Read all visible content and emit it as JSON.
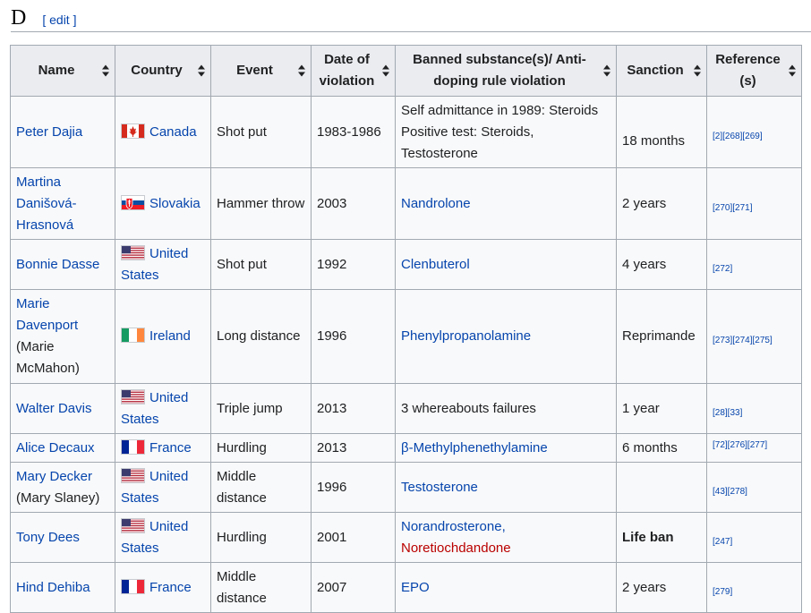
{
  "heading": {
    "title": "D",
    "edit_label": "[ edit ]"
  },
  "columns": [
    "Name",
    "Country",
    "Event",
    "Date of violation",
    "Banned substance(s)/ Anti-doping rule violation",
    "Sanction",
    "Reference (s)"
  ],
  "rows": [
    {
      "name": "Peter Dajia",
      "country": "Canada",
      "flag": "canada-flag-icon",
      "event": "Shot put",
      "date": "1983-1986",
      "substance_lines": [
        "Self admittance in 1989: Steroids",
        "Positive test: Steroids, Testosterone"
      ],
      "sanction": "18 months",
      "refs": "[2][268][269]"
    },
    {
      "name": "Martina Danišová-Hrasnová",
      "country": "Slovakia",
      "flag": "slovakia-flag-icon",
      "event": "Hammer throw",
      "date": "2003",
      "substance": "Nandrolone",
      "sanction": "2 years",
      "refs": "[270][271]"
    },
    {
      "name": "Bonnie Dasse",
      "country": "United States",
      "flag": "united-states-flag-icon",
      "event": "Shot put",
      "date": "1992",
      "substance": "Clenbuterol",
      "sanction": "4 years",
      "refs": "[272]"
    },
    {
      "name": "Marie Davenport",
      "name_note": "(Marie McMahon)",
      "country": "Ireland",
      "flag": "ireland-flag-icon",
      "event": "Long distance",
      "date": "1996",
      "substance": "Phenylpropanolamine",
      "sanction": "Reprimande",
      "refs": "[273][274][275]"
    },
    {
      "name": "Walter Davis",
      "country": "United States",
      "flag": "united-states-flag-icon",
      "event": "Triple jump",
      "date": "2013",
      "substance": "3 whereabouts failures",
      "sanction": "1 year",
      "refs": "[28][33]"
    },
    {
      "name": "Alice Decaux",
      "country": "France",
      "flag": "france-flag-icon",
      "event": "Hurdling",
      "date": "2013",
      "substance": "β-Methylphenethylamine",
      "sanction": "6 months",
      "refs": "[72][276][277]"
    },
    {
      "name": "Mary Decker",
      "name_note": "(Mary Slaney)",
      "country": "United States",
      "flag": "united-states-flag-icon",
      "event": "Middle distance",
      "date": "1996",
      "substance": "Testosterone",
      "sanction": "",
      "refs": "[43][278]"
    },
    {
      "name": "Tony Dees",
      "country": "United States",
      "flag": "united-states-flag-icon",
      "event": "Hurdling",
      "date": "2001",
      "substance": "Norandrosterone,",
      "substance_2": "Noretiochdandone",
      "sanction": "Life ban",
      "refs": "[247]"
    },
    {
      "name": "Hind Dehiba",
      "country": "France",
      "flag": "france-flag-icon",
      "event": "Middle distance",
      "date": "2007",
      "substance": "EPO",
      "sanction": "2 years",
      "refs": "[279]"
    }
  ],
  "colors": {
    "link": "#0645ad",
    "redlink": "#ba0000",
    "header_bg": "#eaecf0",
    "cell_bg": "#f8f9fa",
    "border": "#a2a9b1"
  }
}
